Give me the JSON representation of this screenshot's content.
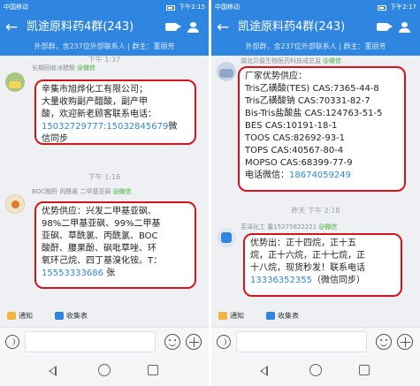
{
  "left": {
    "status": {
      "carrier": "中国移动",
      "right": "下午2:15"
    },
    "header": {
      "back": "←",
      "title": "凯途原料药4群(243)"
    },
    "subheader": "外部群，含237位外部联系人 | 群主：董丽芳",
    "time_partial": "下午 1:37",
    "time_mid": "下午 1:16",
    "messages": [
      {
        "sender": "长期回收冰醋酸",
        "tag": "@微信",
        "lines": [
          "辛集市旭烨化工有限公司；",
          "大量收购副产醋酸，副产甲",
          "酸，欢迎新老顾客联系电话："
        ],
        "link": "15032729777:15032845679",
        "tail": "微",
        "last": "信同步"
      },
      {
        "sender": "BOC酸酐 丙酰氯 二甲基亚砜",
        "tag": "@微信",
        "lines": [
          "优势供应：兴发二甲基亚砜、",
          "98%二甲基亚砜、99%二甲基",
          "亚砜、草酰氯、丙酰氯、BOC",
          "酸酐、腰果酚、砜吡草唑、环",
          "氧环己烷、四丁基溴化铵。T："
        ],
        "link": "15553333686",
        "tail": "张"
      }
    ],
    "toolbar": {
      "notice": "通知",
      "sheet": "收集表"
    }
  },
  "right": {
    "status": {
      "carrier": "中国移动",
      "right": "下午2:17"
    },
    "header": {
      "back": "←",
      "title": "凯途原料药4群(243)"
    },
    "subheader": "外部群，含237位外部联系人 | 群主：董丽芳",
    "time_mid": "昨天 下午 2:18",
    "messages": [
      {
        "sender": "湖北贝俊生物医药科技成总监",
        "tag": "@微信",
        "lines": [
          "厂家优势供应：",
          "Tris乙磺酸(TES) CAS:7365-44-8",
          "Tris乙磺酸钠 CAS:70331-82-7",
          "Bis-Tris盐酸盐 CAS:124763-51-5",
          "BES        CAS:10191-18-1",
          "TOOS       CAS:82692-93-1",
          "TOPS       CAS:40567-80-4",
          "MOPSO   CAS:68399-77-9"
        ],
        "phone_label": "电话微信：",
        "phone": "18674059249"
      },
      {
        "sender": "芜泽化工 董15275822221",
        "tag": "@微信",
        "lines": [
          "优势出：正十四烷，正十五",
          "烷，正十六烷，正十七烷，正",
          "十八烷，现货秒发！联系电话"
        ],
        "link": "13336352355",
        "tail": "（微信同步）"
      }
    ],
    "toolbar": {
      "notice": "通知",
      "sheet": "收集表"
    }
  }
}
